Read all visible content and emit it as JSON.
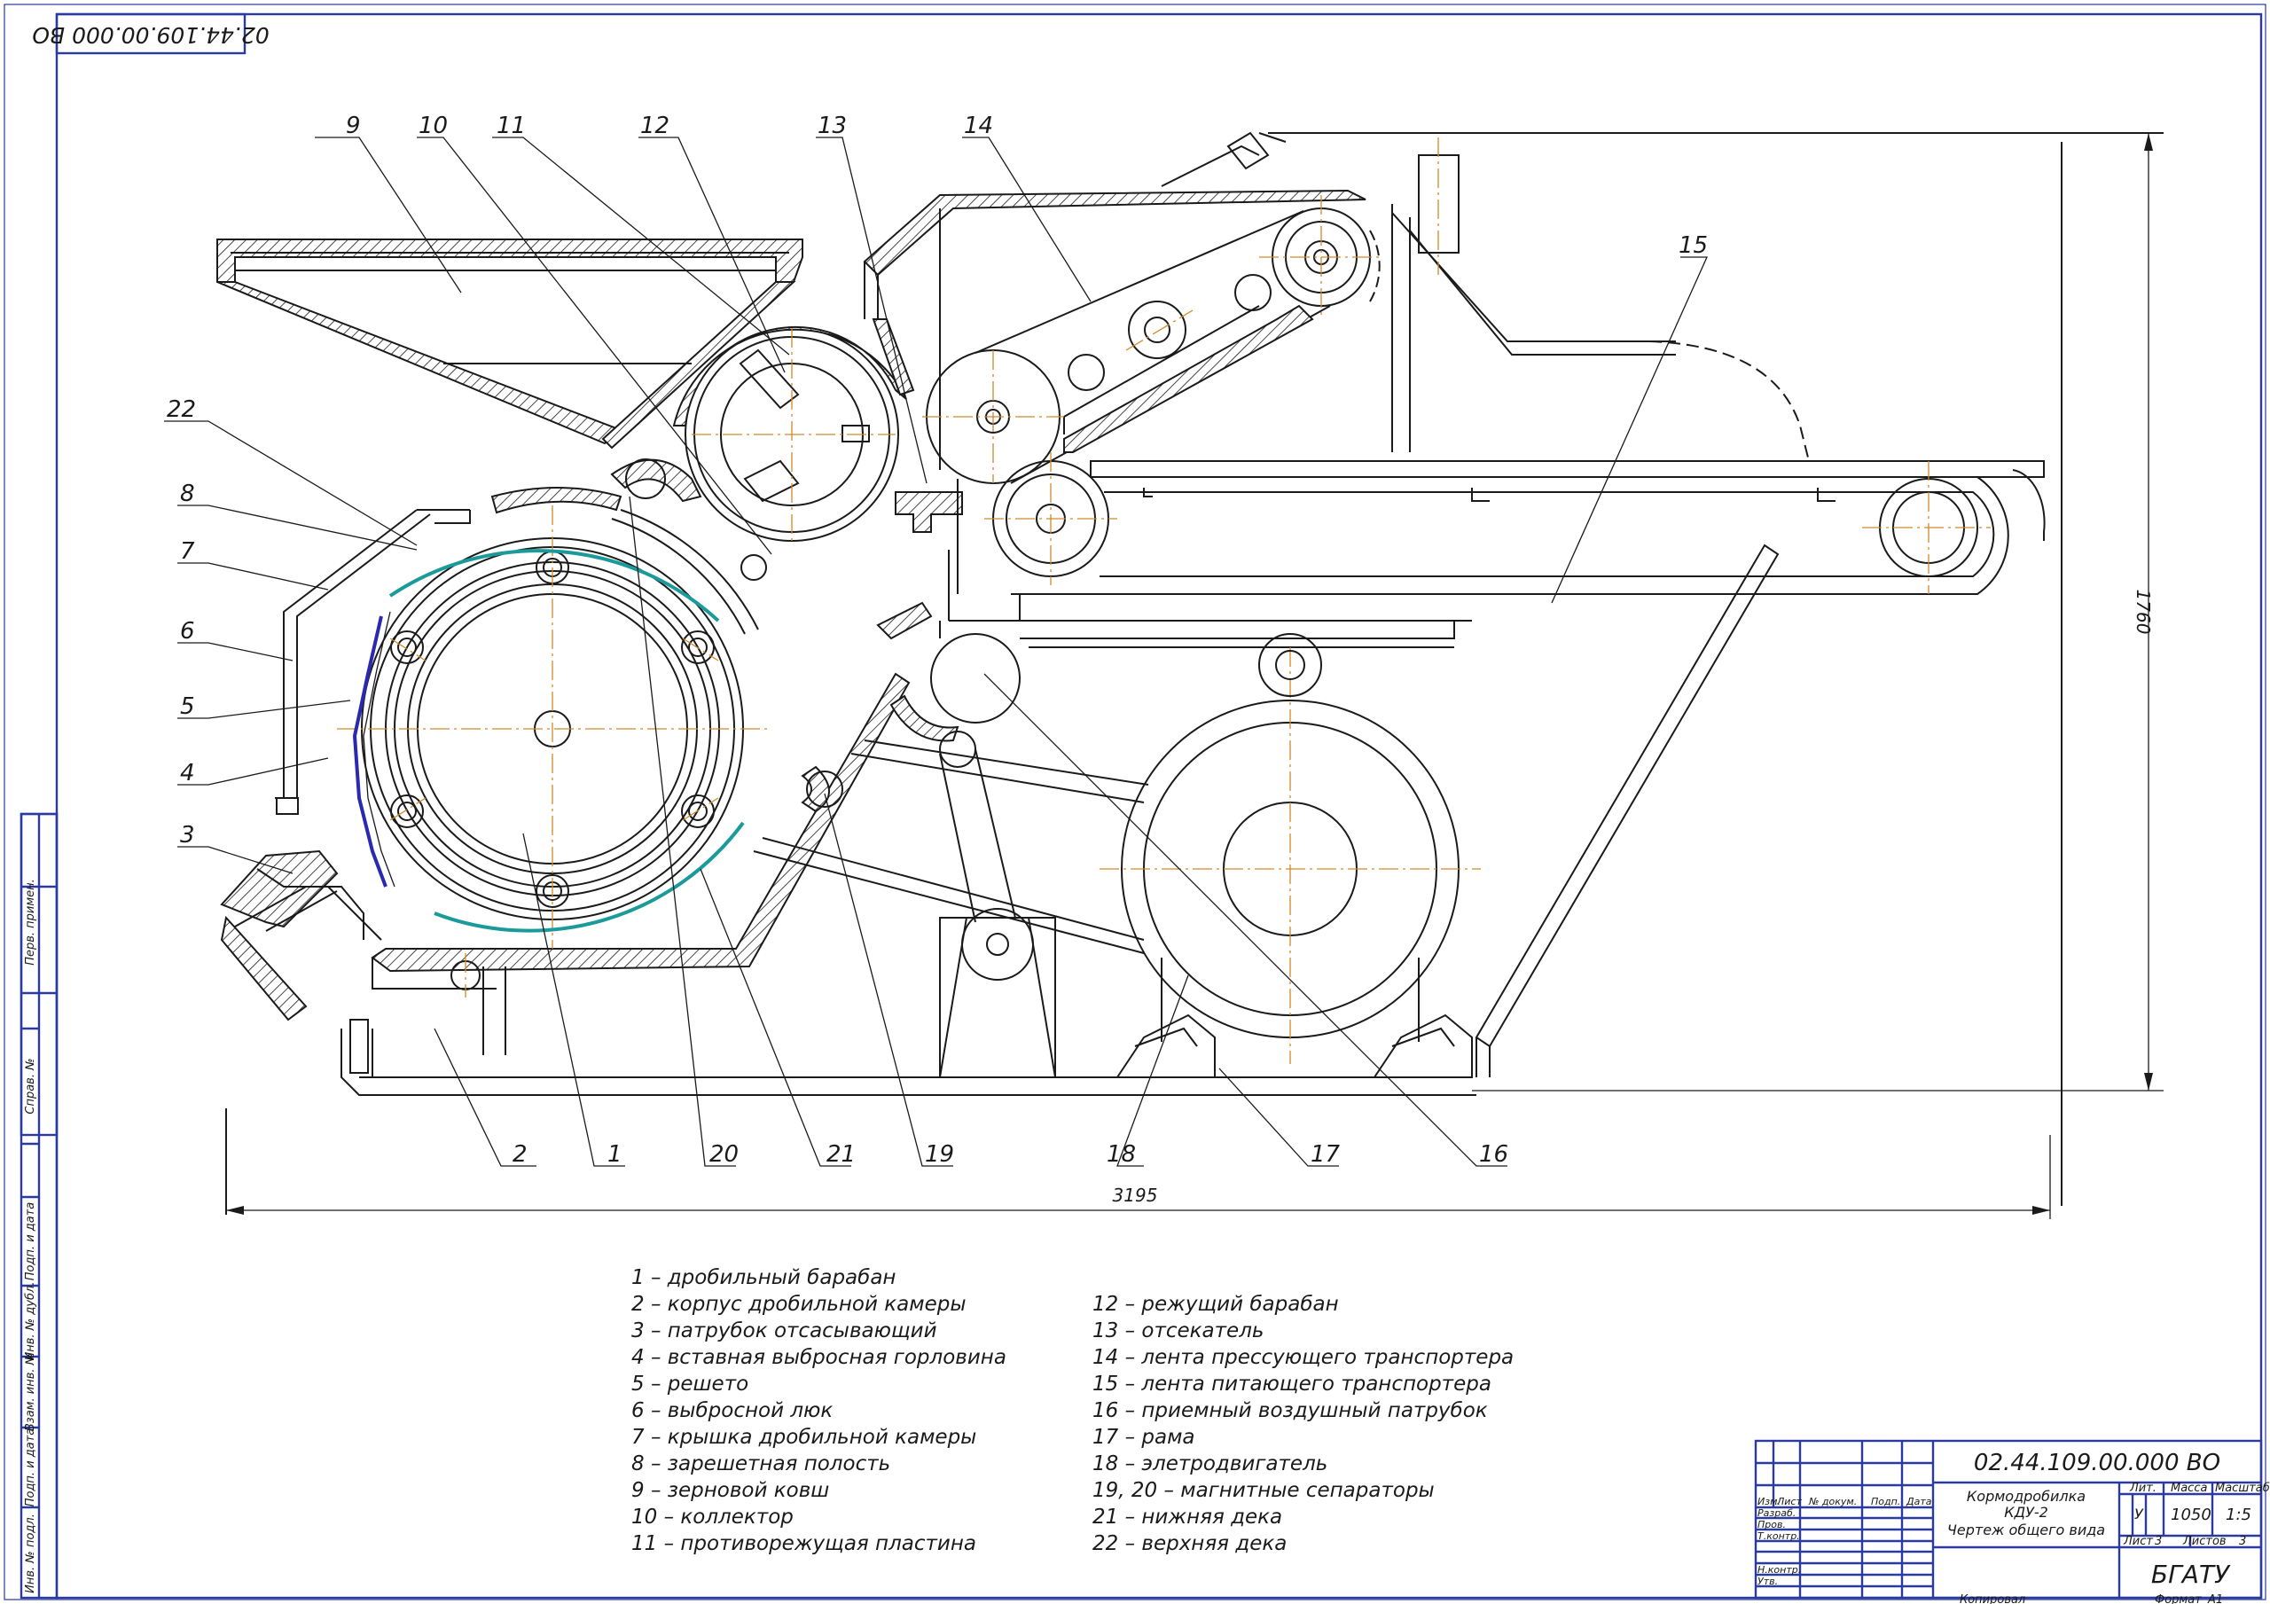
{
  "drawing_code_stamp": "02.44.109.00.000 ВО",
  "callouts": [
    "1",
    "2",
    "3",
    "4",
    "5",
    "6",
    "7",
    "8",
    "9",
    "10",
    "11",
    "12",
    "13",
    "14",
    "15",
    "16",
    "17",
    "18",
    "19",
    "20",
    "21",
    "22"
  ],
  "dimensions": {
    "width": "3195",
    "height": "1760"
  },
  "legend_left": [
    "1 – дробильный барабан",
    "2 – корпус дробильной камеры",
    "3 – патрубок отсасывающий",
    "4 – вставная выбросная горловина",
    "5 – решето",
    "6 – выбросной люк",
    "7 – крышка дробильной камеры",
    "8 – зарешетная полость",
    "9 – зерновой ковш",
    "10 – коллектор",
    "11 – противорежущая пластина"
  ],
  "legend_right": [
    "12 – режущий барабан",
    "13 – отсекатель",
    "14 – лента прессующего транспортера",
    "15 – лента питающего транспортера",
    "16 – приемный воздушный патрубок",
    "17 – рама",
    "18 – элетродвигатель",
    "19, 20 – магнитные сепараторы",
    "21 – нижняя дека",
    "22 – верхняя дека"
  ],
  "side_column": [
    "Перв. примен.",
    "Справ. №",
    "Подп. и дата",
    "Инв. № дубл.",
    "Взам. инв. №",
    "Подп. и дата",
    "Инв. № подл."
  ],
  "title_block": {
    "code": "02.44.109.00.000 ВО",
    "name_line1": "Кормодробилка",
    "name_line2": "КДУ-2",
    "name_line3": "Чертеж общего вида",
    "col_headers": [
      "Изм.",
      "Лист",
      "№ докум.",
      "Подп.",
      "Дата"
    ],
    "row_labels": [
      "Разраб.",
      "Пров.",
      "Т.контр.",
      "Н.контр.",
      "Утв."
    ],
    "lit_label": "Лит.",
    "mass_label": "Масса",
    "scale_label": "Масштаб",
    "lit_value": "У",
    "mass_value": "1050",
    "scale_value": "1:5",
    "sheet_label": "Лист",
    "sheet_value": "3",
    "sheets_label": "Листов",
    "sheets_value": "3",
    "organization": "БГАТУ",
    "copied_label": "Копировал",
    "format_label": "Формат",
    "format_value": "А1"
  },
  "colors": {
    "frame": "#2a3aa0",
    "deck": "#1a9a9a",
    "sieve": "#2a2ab0",
    "axis": "#d08a2a"
  }
}
